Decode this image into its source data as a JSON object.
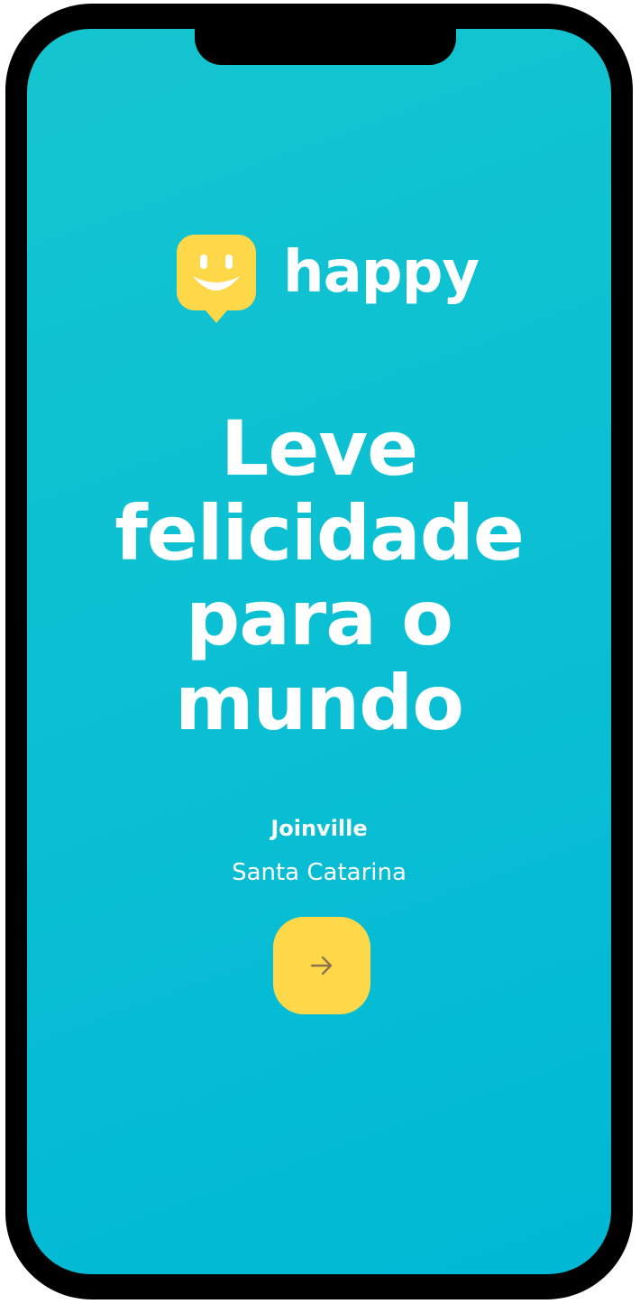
{
  "brand": {
    "name": "happy",
    "logo_icon": "smiley-speech-bubble-icon"
  },
  "hero": {
    "headline_lines": [
      "Leve",
      "felicidade",
      "para o",
      "mundo"
    ]
  },
  "location": {
    "city": "Joinville",
    "state": "Santa Catarina"
  },
  "actions": {
    "next_icon": "arrow-right-icon"
  },
  "colors": {
    "background": "#00bdd3",
    "accent": "#ffd84a",
    "text": "#ffffff",
    "arrow": "#8d734b"
  }
}
